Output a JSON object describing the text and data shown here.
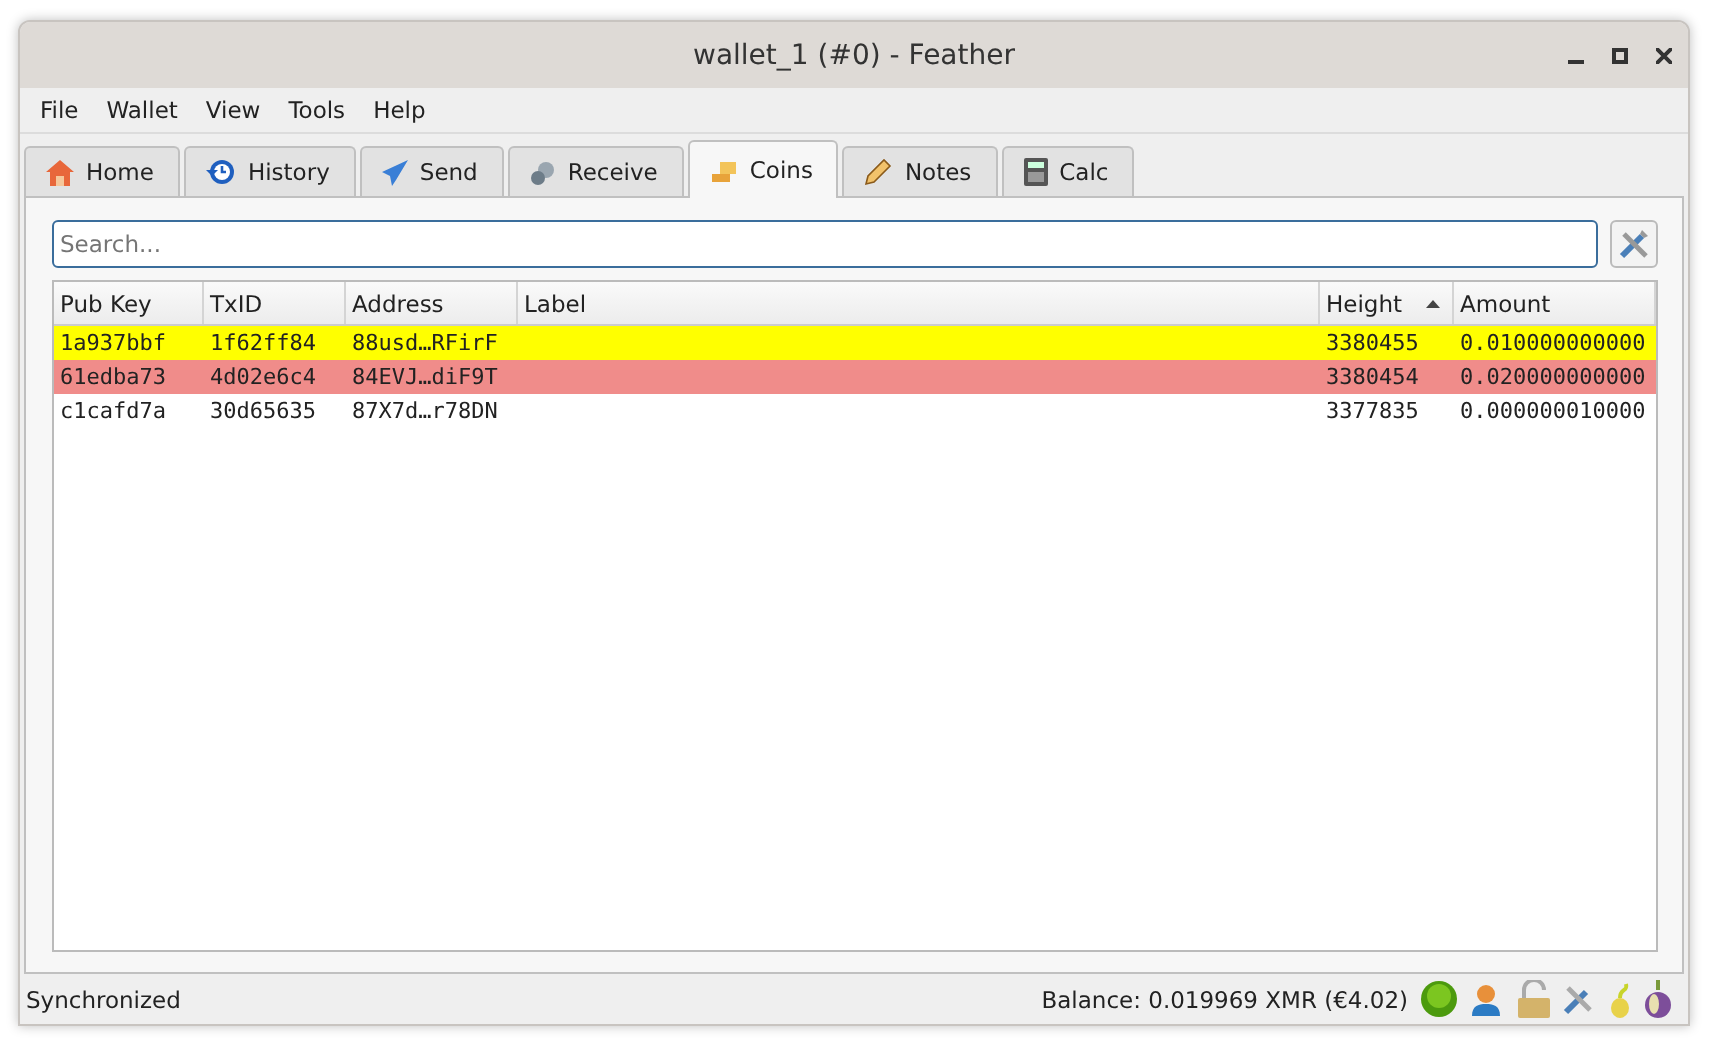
{
  "window": {
    "title": "wallet_1 (#0) - Feather"
  },
  "menu": [
    "File",
    "Wallet",
    "View",
    "Tools",
    "Help"
  ],
  "tabs": [
    {
      "label": "Home",
      "kind": "home",
      "selected": false
    },
    {
      "label": "History",
      "kind": "history",
      "selected": false
    },
    {
      "label": "Send",
      "kind": "send",
      "selected": false
    },
    {
      "label": "Receive",
      "kind": "receive",
      "selected": false
    },
    {
      "label": "Coins",
      "kind": "coins",
      "selected": true
    },
    {
      "label": "Notes",
      "kind": "notes",
      "selected": false
    },
    {
      "label": "Calc",
      "kind": "calc",
      "selected": false
    }
  ],
  "search": {
    "placeholder": "Search..."
  },
  "table": {
    "columns": [
      {
        "label": "Pub Key",
        "sorted": false
      },
      {
        "label": "TxID",
        "sorted": false
      },
      {
        "label": "Address",
        "sorted": false
      },
      {
        "label": "Label",
        "sorted": false
      },
      {
        "label": "Height",
        "sorted": true
      },
      {
        "label": "Amount",
        "sorted": false
      }
    ],
    "rows": [
      {
        "cells": [
          "1a937bbf",
          "1f62ff84",
          "88usd…RFirF",
          "",
          "3380455",
          "0.010000000000"
        ],
        "color": "#ffff00"
      },
      {
        "cells": [
          "61edba73",
          "4d02e6c4",
          "84EVJ…diF9T",
          "",
          "3380454",
          "0.020000000000"
        ],
        "color": "#f08c8a"
      },
      {
        "cells": [
          "c1cafd7a",
          "30d65635",
          "87X7d…r78DN",
          "",
          "3377835",
          "0.000000010000"
        ],
        "color": "#ffffff"
      }
    ]
  },
  "status_bar": {
    "status": "Synchronized",
    "balance": "Balance: 0.019969 XMR (€4.02)"
  }
}
